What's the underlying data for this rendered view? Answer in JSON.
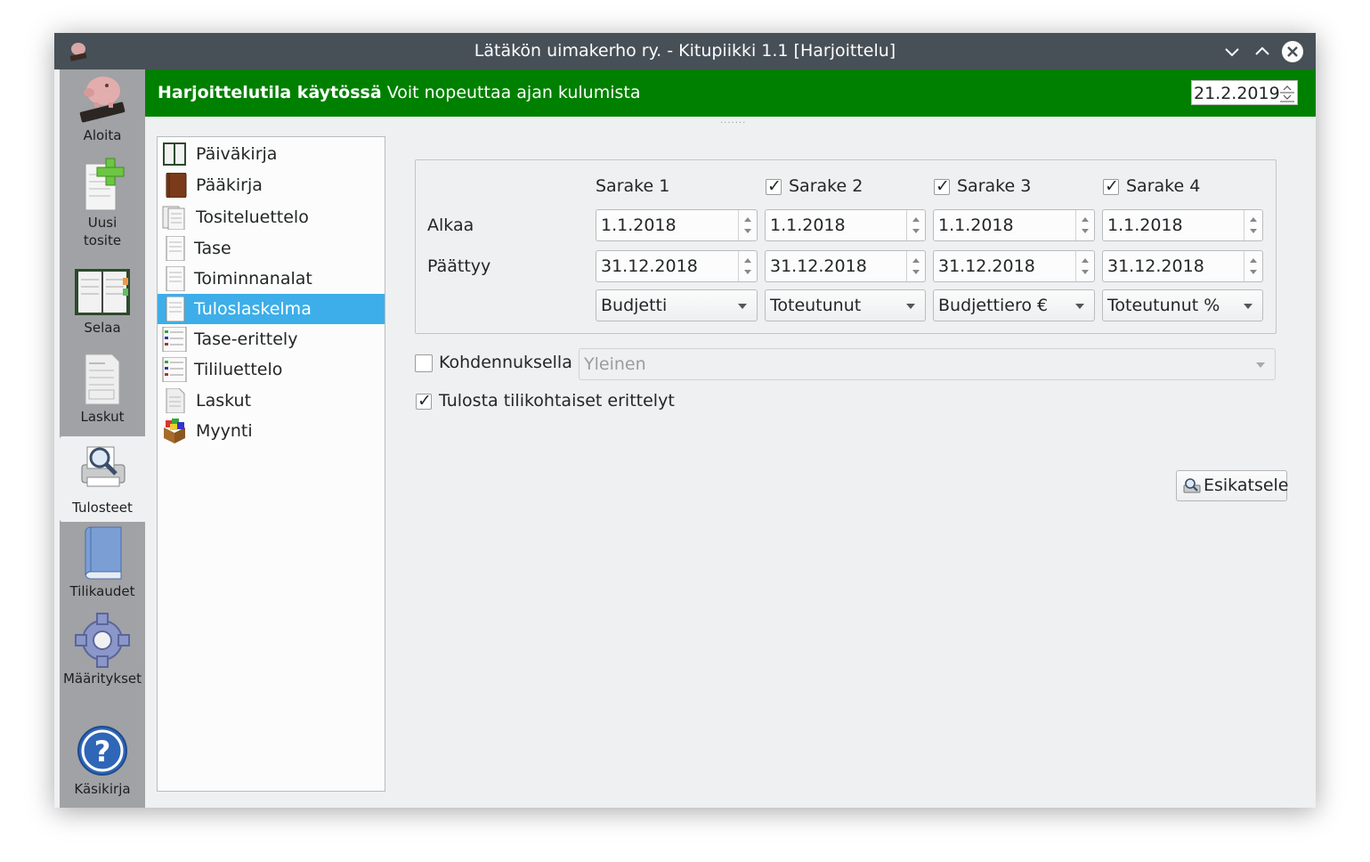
{
  "window": {
    "title": "Lätäkön uimakerho ry. - Kitupiikki 1.1 [Harjoittelu]",
    "controls": [
      "minimize-icon",
      "maximize-icon",
      "close-icon"
    ]
  },
  "sidebar": {
    "items": [
      {
        "label": "Aloita",
        "icon": "piggy-bank-icon"
      },
      {
        "label": "Uusi tosite",
        "icon": "new-document-icon"
      },
      {
        "label": "Selaa",
        "icon": "calendar-book-icon"
      },
      {
        "label": "Laskut",
        "icon": "invoice-icon"
      },
      {
        "label": "Tulosteet",
        "icon": "print-preview-icon",
        "active": true
      },
      {
        "label": "Tilikaudet",
        "icon": "book-icon"
      },
      {
        "label": "Määritykset",
        "icon": "gear-icon"
      },
      {
        "label": "Käsikirja",
        "icon": "help-icon"
      }
    ]
  },
  "banner": {
    "bold_text": "Harjoittelutila käytössä",
    "text": "Voit nopeuttaa ajan kulumista",
    "date": "21.2.2019",
    "color": "#008000"
  },
  "reports": {
    "items": [
      {
        "label": "Päiväkirja",
        "icon": "journal-icon"
      },
      {
        "label": "Pääkirja",
        "icon": "ledger-icon"
      },
      {
        "label": "Tositeluettelo",
        "icon": "documents-icon"
      },
      {
        "label": "Tase",
        "icon": "page-icon"
      },
      {
        "label": "Toiminnanalat",
        "icon": "page-icon"
      },
      {
        "label": "Tuloslaskelma",
        "icon": "page-icon",
        "selected": true
      },
      {
        "label": "Tase-erittely",
        "icon": "list-icon"
      },
      {
        "label": "Tililuettelo",
        "icon": "list-icon"
      },
      {
        "label": "Laskut",
        "icon": "documents-icon"
      },
      {
        "label": "Myynti",
        "icon": "box-icon"
      }
    ],
    "selection_color": "#3daee9"
  },
  "columns_group": {
    "row_labels": {
      "start": "Alkaa",
      "end": "Päättyy"
    },
    "columns": [
      {
        "header": "Sarake 1",
        "has_checkbox": false,
        "checked": true,
        "start": "1.1.2018",
        "end": "31.12.2018",
        "type": "Budjetti"
      },
      {
        "header": "Sarake 2",
        "has_checkbox": true,
        "checked": true,
        "start": "1.1.2018",
        "end": "31.12.2018",
        "type": "Toteutunut"
      },
      {
        "header": "Sarake 3",
        "has_checkbox": true,
        "checked": true,
        "start": "1.1.2018",
        "end": "31.12.2018",
        "type": "Budjettiero €"
      },
      {
        "header": "Sarake 4",
        "has_checkbox": true,
        "checked": true,
        "start": "1.1.2018",
        "end": "31.12.2018",
        "type": "Toteutunut %"
      }
    ]
  },
  "options": {
    "allocation_label": "Kohdennuksella",
    "allocation_checked": false,
    "allocation_value": "Yleinen",
    "print_details_label": "Tulosta tilikohtaiset erittelyt",
    "print_details_checked": true
  },
  "actions": {
    "preview_label": "Esikatsele"
  }
}
